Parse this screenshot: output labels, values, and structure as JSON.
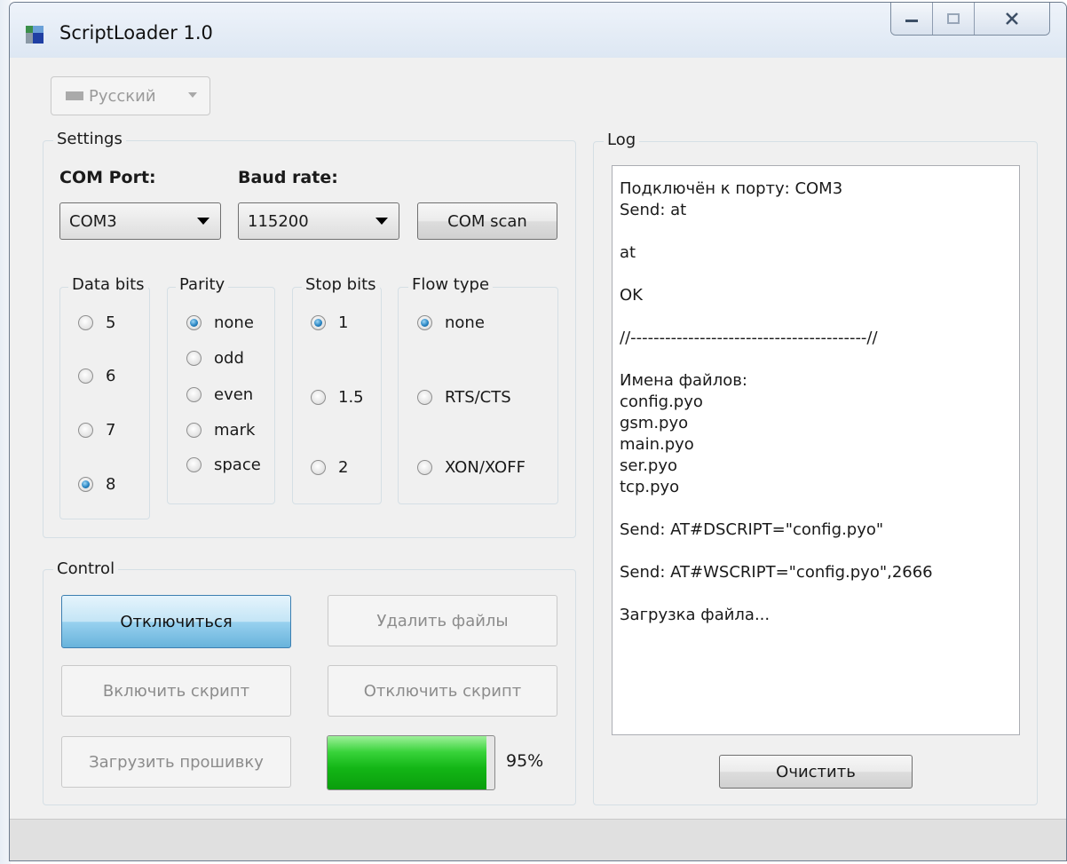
{
  "window": {
    "title": "ScriptLoader 1.0"
  },
  "language": {
    "selected": "Русский"
  },
  "settings": {
    "legend": "Settings",
    "com_port_label": "COM Port:",
    "com_port_value": "COM3",
    "baud_rate_label": "Baud rate:",
    "baud_rate_value": "115200",
    "com_scan_button": "COM scan",
    "data_bits": {
      "legend": "Data bits",
      "options": [
        "5",
        "6",
        "7",
        "8"
      ],
      "selected": "8"
    },
    "parity": {
      "legend": "Parity",
      "options": [
        "none",
        "odd",
        "even",
        "mark",
        "space"
      ],
      "selected": "none"
    },
    "stop_bits": {
      "legend": "Stop bits",
      "options": [
        "1",
        "1.5",
        "2"
      ],
      "selected": "1"
    },
    "flow_type": {
      "legend": "Flow type",
      "options": [
        "none",
        "RTS/CTS",
        "XON/XOFF"
      ],
      "selected": "none"
    }
  },
  "control": {
    "legend": "Control",
    "disconnect_button": "Отключиться",
    "delete_files_button": "Удалить файлы",
    "enable_script_button": "Включить скрипт",
    "disable_script_button": "Отключить скрипт",
    "upload_firmware_button": "Загрузить прошивку",
    "progress_percent": 95,
    "progress_label": "95%"
  },
  "log": {
    "legend": "Log",
    "lines": [
      "Подключён к порту: COM3",
      "Send: at",
      "",
      "at",
      "",
      "OK",
      "",
      "//-----------------------------------------//",
      "",
      "Имена файлов:",
      "config.pyo",
      "gsm.pyo",
      "main.pyo",
      "ser.pyo",
      "tcp.pyo",
      "",
      "Send: AT#DSCRIPT=\"config.pyo\"",
      "",
      "Send: AT#WSCRIPT=\"config.pyo\",2666",
      "",
      "Загрузка файла..."
    ],
    "clear_button": "Очистить"
  },
  "colors": {
    "progress_fill": "#13b616",
    "primary_button": "#98d1ef",
    "window_bg": "#f0f0f0"
  }
}
